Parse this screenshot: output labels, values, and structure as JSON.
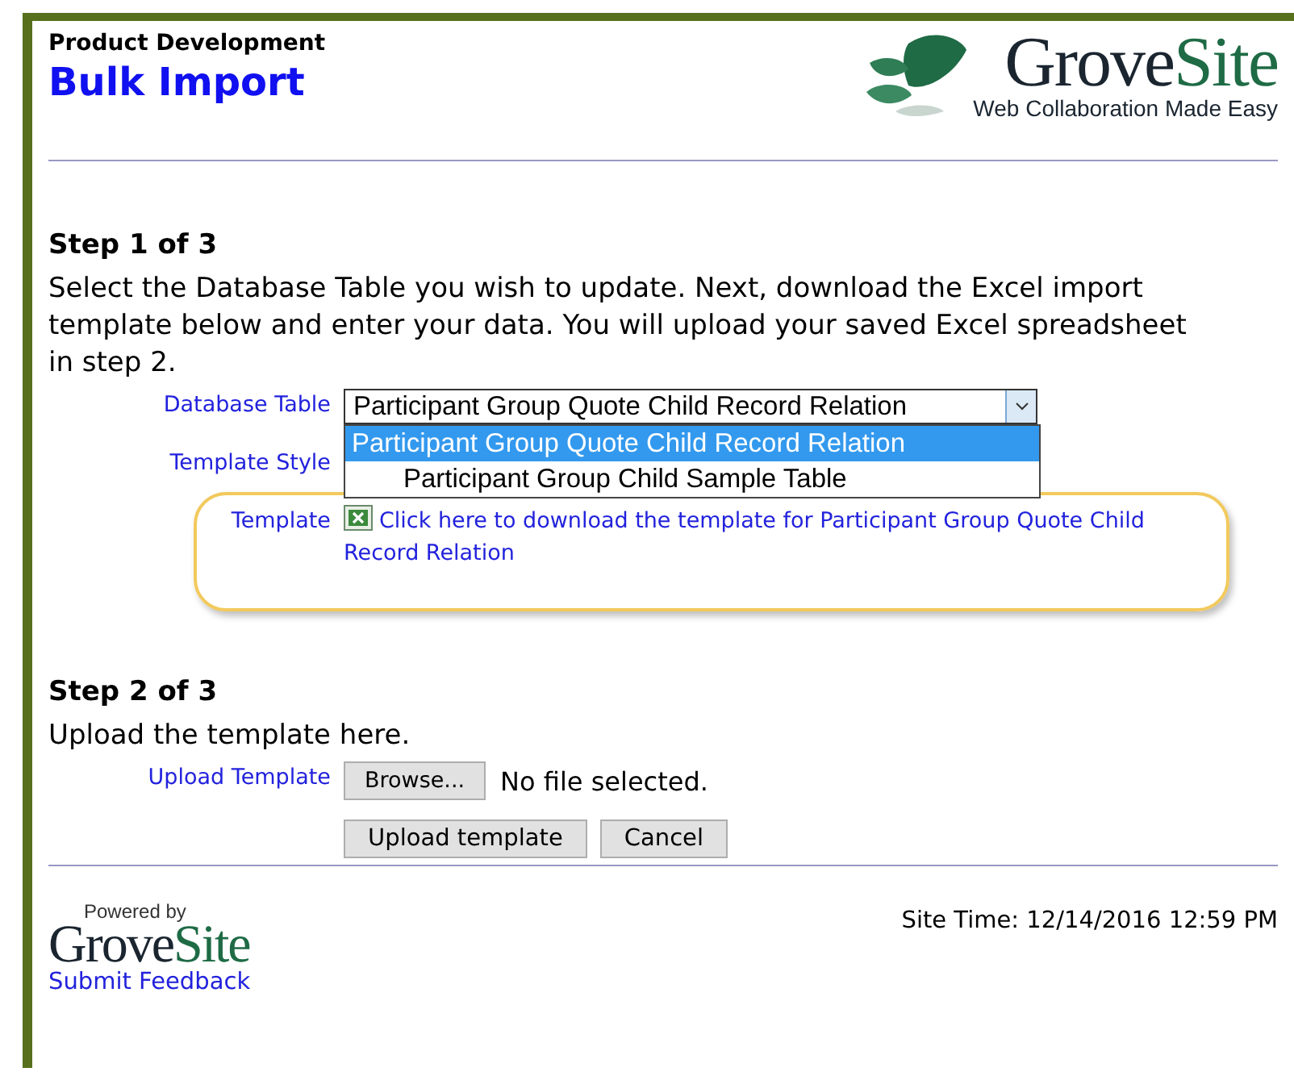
{
  "header": {
    "breadcrumb": "Product Development",
    "title": "Bulk Import",
    "logo": {
      "wordmark": [
        "Grove",
        "Site"
      ],
      "tagline": "Web Collaboration Made Easy"
    }
  },
  "step1": {
    "heading": "Step 1 of 3",
    "instructions": "Select the Database Table you wish to update. Next, download the Excel import template below and enter your data. You will upload your saved Excel spreadsheet in step 2.",
    "database_table": {
      "label": "Database Table",
      "value": "Participant Group Quote Child Record Relation",
      "expanded": true,
      "options": [
        {
          "label": "Participant Group Quote Child Record Relation",
          "selected": true
        },
        {
          "label": "Participant Group Child Sample Table",
          "selected": false
        }
      ]
    },
    "template_style": {
      "label": "Template Style"
    },
    "template": {
      "label": "Template",
      "link": "Click here to download the template for Participant Group Quote Child Record Relation",
      "highlighted": true
    }
  },
  "step2": {
    "heading": "Step 2 of 3",
    "instructions": "Upload the template here.",
    "upload": {
      "label": "Upload Template",
      "browse_button": "Browse...",
      "file_status": "No file selected."
    },
    "buttons": [
      "Upload template",
      "Cancel"
    ]
  },
  "footer": {
    "powered_by": "Powered by",
    "wordmark": [
      "Grove",
      "Site"
    ],
    "feedback_link": "Submit Feedback",
    "site_time": "Site Time: 12/14/2016 12:59 PM"
  }
}
